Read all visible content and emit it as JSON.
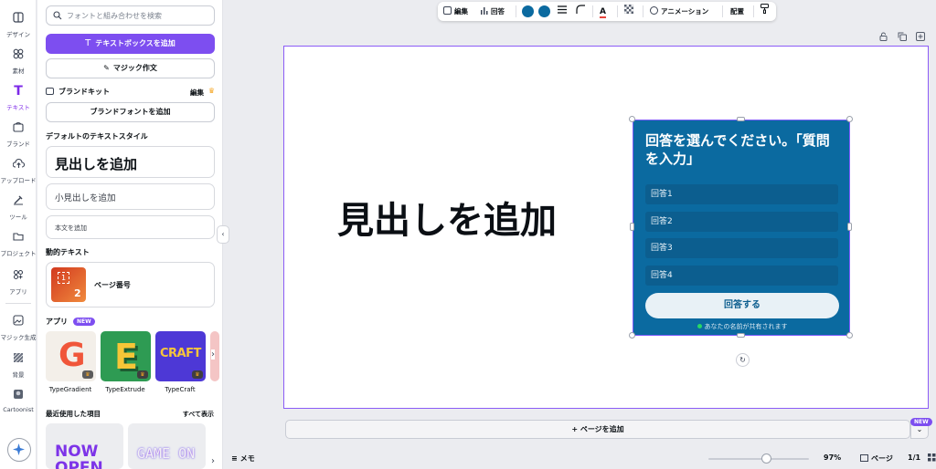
{
  "rail": {
    "items": [
      {
        "label": "デザイン",
        "icon": "design-icon"
      },
      {
        "label": "素材",
        "icon": "elements-icon"
      },
      {
        "label": "テキスト",
        "icon": "text-icon"
      },
      {
        "label": "ブランド",
        "icon": "brand-icon"
      },
      {
        "label": "アップロード",
        "icon": "upload-icon"
      },
      {
        "label": "ツール",
        "icon": "tools-icon"
      },
      {
        "label": "プロジェクト",
        "icon": "folder-icon"
      },
      {
        "label": "アプリ",
        "icon": "apps-icon"
      },
      {
        "label": "マジック生成",
        "icon": "magic-media-icon"
      },
      {
        "label": "背景",
        "icon": "background-icon"
      },
      {
        "label": "Cartoonist",
        "icon": "cartoonist-icon"
      }
    ],
    "active_color": "#7d2ae8"
  },
  "panel": {
    "search_placeholder": "フォントと組み合わせを検索",
    "add_textbox": "テキストボックスを追加",
    "magic_write": "マジック作文",
    "brand_kit": "ブランドキット",
    "brand_kit_edit": "編集",
    "add_brand_fonts": "ブランドフォントを追加",
    "default_styles_title": "デフォルトのテキストスタイル",
    "add_heading": "見出しを追加",
    "add_subheading": "小見出しを追加",
    "add_body": "本文を追加",
    "dynamic_text_title": "動的テキスト",
    "page_number": "ページ番号",
    "page_number_thumb": [
      "1",
      "2"
    ],
    "apps_title": "アプリ",
    "apps_new_badge": "NEW",
    "apps": [
      {
        "name": "TypeGradient",
        "glyph": "G",
        "bg": "#f3efe9",
        "fg": "#f0563a"
      },
      {
        "name": "TypeExtrude",
        "glyph": "E",
        "bg": "#2e9b53",
        "fg": "#f6c637"
      },
      {
        "name": "TypeCraft",
        "glyph": "CRAFT",
        "bg": "#4d38d6",
        "fg": "#f7c53a"
      }
    ],
    "recent_title": "最近使用した項目",
    "see_all": "すべて表示",
    "recent_tiles": [
      "NOW OPEN",
      "GAME ON"
    ]
  },
  "toolbar": {
    "edit": "編集",
    "answers": "回答",
    "color_1": "#0b6aa0",
    "color_2": "#0b6aa0",
    "animate": "アニメーション",
    "position": "配置"
  },
  "canvas": {
    "heading": "見出しを追加",
    "poll": {
      "question": "回答を選んでください。「質問を入力」",
      "options": [
        "回答1",
        "回答2",
        "回答3",
        "回答4"
      ],
      "submit": "回答する",
      "note": "あなたの名前が共有されます",
      "bg": "#0b6aa0"
    },
    "add_page": "+ ページを追加",
    "new_badge": "NEW"
  },
  "bottombar": {
    "notes": "メモ",
    "zoom": "97%",
    "pages": "ページ",
    "page_count": "1/1"
  }
}
